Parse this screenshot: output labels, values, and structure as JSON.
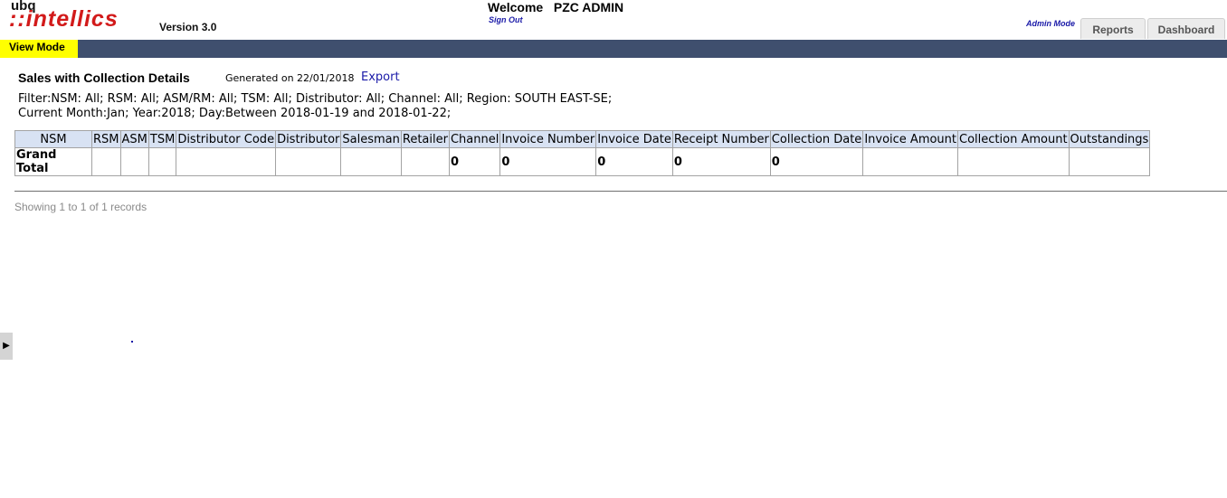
{
  "header": {
    "logo_top": "ubq",
    "logo_main": "::intellics",
    "version": "Version 3.0",
    "welcome": "Welcome   PZC ADMIN",
    "sign_out": "Sign Out",
    "admin_mode": "Admin Mode",
    "tabs": [
      {
        "label": "Reports"
      },
      {
        "label": "Dashboard"
      }
    ],
    "view_mode": "View Mode"
  },
  "report": {
    "title": "Sales with Collection Details",
    "generated": "Generated on 22/01/2018",
    "export": "Export",
    "filter_line_1": "Filter:NSM: All; RSM: All; ASM/RM: All; TSM: All; Distributor: All; Channel: All; Region: SOUTH EAST-SE;",
    "filter_line_2": "Current Month:Jan; Year:2018; Day:Between 2018-01-19 and 2018-01-22;",
    "columns": [
      "NSM",
      "RSM",
      "ASM",
      "TSM",
      "Distributor Code",
      "Distributor",
      "Salesman",
      "Retailer",
      "Channel",
      "Invoice Number",
      "Invoice Date",
      "Receipt Number",
      "Collection Date",
      "Invoice Amount",
      "Collection Amount",
      "Outstandings"
    ],
    "rows": [
      [
        "Grand Total",
        "",
        "",
        "",
        "",
        "",
        "",
        "",
        "0",
        "0",
        "0",
        "0",
        "0",
        "",
        "",
        ""
      ]
    ],
    "showing": "Showing 1 to 1 of 1 records"
  },
  "side_toggle_icon": "▶",
  "colors": {
    "nav_bar": "#3f4f6e",
    "view_mode_bg": "#ffff00",
    "header_cell_bg": "#d8e2f3",
    "logo_red": "#d21a1a",
    "link_blue": "#1a1aa8"
  }
}
